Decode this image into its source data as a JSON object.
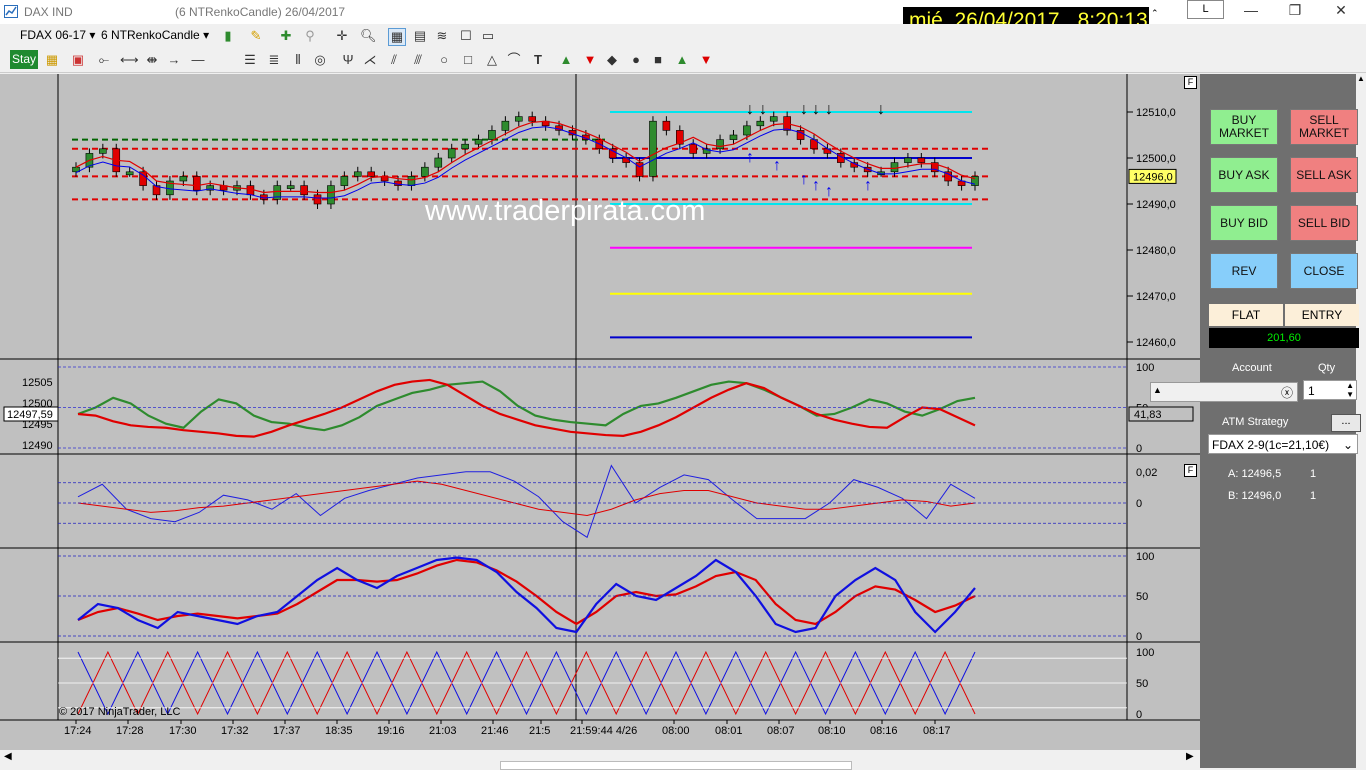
{
  "window": {
    "title": "DAX IND",
    "subtitle": "(6 NTRenkoCandle)  26/04/2017",
    "l_button": "L",
    "min_glyph": "—",
    "max_glyph": "❐",
    "close_glyph": "✕"
  },
  "clock": {
    "date": "mié. 26/04/2017",
    "time": "8:20:13"
  },
  "toolbar": {
    "instrument": "FDAX 06-17",
    "bartype": "6 NTRenkoCandle",
    "dropdown_glyph": "▾",
    "stay_label": "Stay"
  },
  "watermark": "www.traderpirata.com",
  "copyright": "© 2017 NinjaTrader, LLC",
  "colors": {
    "bull": "#2e8b2e",
    "bear": "#e00000",
    "panel_bg": "#c0c0c0",
    "accent_cyan": "#00e5ee",
    "accent_magenta": "#ff00ff",
    "accent_yellow": "#ffff00"
  },
  "price_axis": {
    "ticks": [
      "12510,0",
      "12500,0",
      "12490,0",
      "12480,0",
      "12470,0",
      "12460,0"
    ],
    "current": "12496,0"
  },
  "osc1_axis": {
    "right_ticks": [
      "100",
      "50",
      "0"
    ],
    "left_ticks": [
      "12505",
      "12500",
      "12495",
      "12490"
    ],
    "left_marker": "12497,59",
    "right_marker": "41,83"
  },
  "osc2_axis": {
    "right_ticks": [
      "0,02",
      "0"
    ]
  },
  "osc3_axis": {
    "right_ticks": [
      "100",
      "50",
      "0"
    ]
  },
  "osc4_axis": {
    "right_ticks": [
      "100",
      "50",
      "0"
    ]
  },
  "time_axis": [
    "17:24",
    "17:28",
    "17:30",
    "17:32",
    "17:37",
    "18:35",
    "19:16",
    "21:03",
    "21:46",
    "21:5",
    "21:59:44 4/26",
    "08:00",
    "08:01",
    "08:07",
    "08:10",
    "08:16",
    "08:17"
  ],
  "panel_flag": "F",
  "chart_data": {
    "type": "line",
    "title": "",
    "xlabel": "",
    "ylabel": "",
    "ylim": [
      12457,
      12514
    ],
    "price_closes": [
      12498,
      12501,
      12502,
      12497,
      12497,
      12494,
      12492,
      12495,
      12496,
      12493,
      12494,
      12493,
      12494,
      12492,
      12491,
      12494,
      12494,
      12492,
      12490,
      12494,
      12496,
      12497,
      12496,
      12495,
      12494,
      12496,
      12498,
      12500,
      12502,
      12503,
      12504,
      12506,
      12508,
      12509,
      12508,
      12507,
      12506,
      12505,
      12504,
      12502,
      12500,
      12499,
      12496,
      12508,
      12506,
      12503,
      12501,
      12502,
      12504,
      12505,
      12507,
      12508,
      12509,
      12506,
      12504,
      12502,
      12501,
      12499,
      12498,
      12497,
      12497,
      12499,
      12500,
      12499,
      12497,
      12495,
      12494,
      12496
    ],
    "levels": [
      {
        "value": 12504,
        "color": "#006400",
        "style": "dashed"
      },
      {
        "value": 12502,
        "color": "#e00000",
        "style": "dashed"
      },
      {
        "value": 12496,
        "color": "#e00000",
        "style": "dashed"
      },
      {
        "value": 12491,
        "color": "#e00000",
        "style": "dashed"
      },
      {
        "value": 12510,
        "color": "#00e5ee",
        "style": "solid"
      },
      {
        "value": 12500,
        "color": "#0000cc",
        "style": "solid"
      },
      {
        "value": 12490,
        "color": "#00e5ee",
        "style": "solid"
      },
      {
        "value": 12480.5,
        "color": "#ff00ff",
        "style": "solid"
      },
      {
        "value": 12470.5,
        "color": "#ffff00",
        "style": "solid"
      },
      {
        "value": 12461,
        "color": "#0000cc",
        "style": "solid"
      }
    ],
    "osc1": {
      "green": [
        42,
        50,
        62,
        55,
        40,
        30,
        25,
        45,
        60,
        55,
        40,
        32,
        30,
        25,
        22,
        28,
        38,
        52,
        60,
        68,
        72,
        78,
        80,
        82,
        70,
        52,
        40,
        35,
        32,
        30,
        28,
        42,
        52,
        55,
        62,
        70,
        78,
        82,
        80,
        72,
        62,
        52,
        40,
        42,
        50,
        60,
        55,
        45,
        40,
        48,
        58,
        62
      ],
      "red": [
        42,
        40,
        33,
        28,
        26,
        25,
        22,
        20,
        18,
        15,
        14,
        20,
        28,
        35,
        42,
        50,
        60,
        70,
        78,
        82,
        84,
        78,
        65,
        52,
        42,
        35,
        28,
        24,
        20,
        18,
        16,
        15,
        20,
        28,
        38,
        50,
        62,
        72,
        80,
        74,
        62,
        52,
        42,
        35,
        30,
        26,
        25,
        38,
        50,
        48,
        38,
        28
      ]
    },
    "osc2": {
      "blue": [
        0.004,
        0.012,
        -0.004,
        -0.01,
        -0.012,
        -0.006,
        0.005,
        0.002,
        -0.004,
        0.006,
        -0.008,
        0.003,
        0.008,
        0.012,
        0.016,
        0.018,
        0.02,
        0.02,
        0.014,
        0.004,
        -0.012,
        -0.022,
        0.024,
        0.0,
        0.01,
        0.018,
        0.015,
        0.002,
        -0.01,
        -0.01,
        -0.01,
        0.0,
        0.015,
        0.01,
        0.003,
        -0.01,
        0.012,
        0.003
      ],
      "red": [
        0.0,
        -0.002,
        -0.004,
        -0.006,
        -0.005,
        -0.003,
        -0.002,
        0.0,
        0.002,
        0.004,
        0.006,
        0.008,
        0.01,
        0.012,
        0.014,
        0.012,
        0.008,
        0.004,
        0.0,
        -0.004,
        -0.006,
        -0.008,
        -0.004,
        0.002,
        0.006,
        0.008,
        0.008,
        0.004,
        0.0,
        -0.002,
        -0.004,
        -0.004,
        -0.002,
        0.0,
        0.002,
        0.001,
        -0.002,
        0.0
      ]
    },
    "osc3": {
      "blue": [
        20,
        40,
        35,
        20,
        10,
        30,
        25,
        20,
        15,
        25,
        30,
        50,
        70,
        85,
        70,
        60,
        75,
        85,
        95,
        98,
        95,
        80,
        55,
        35,
        10,
        5,
        40,
        65,
        50,
        45,
        60,
        75,
        95,
        80,
        50,
        15,
        5,
        10,
        50,
        70,
        85,
        70,
        30,
        5,
        30,
        60
      ],
      "red": [
        20,
        30,
        35,
        28,
        20,
        25,
        28,
        25,
        22,
        25,
        28,
        40,
        55,
        70,
        70,
        68,
        70,
        78,
        88,
        95,
        92,
        82,
        68,
        50,
        30,
        15,
        30,
        50,
        55,
        50,
        52,
        62,
        75,
        80,
        70,
        40,
        20,
        15,
        30,
        50,
        62,
        58,
        45,
        30,
        38,
        50
      ]
    },
    "osc4": {
      "blue": [
        100,
        0,
        100,
        0,
        100,
        0,
        100,
        0,
        100,
        0,
        100,
        0,
        100,
        0,
        100,
        0,
        100,
        0,
        100,
        0,
        100,
        0,
        100,
        0,
        100,
        0,
        100,
        0,
        100,
        0,
        100
      ],
      "red": [
        0,
        100,
        0,
        100,
        0,
        100,
        0,
        100,
        0,
        100,
        0,
        100,
        0,
        100,
        0,
        100,
        0,
        100,
        0,
        100,
        0,
        100,
        0,
        100,
        0,
        100,
        0,
        100,
        0,
        100,
        0
      ]
    }
  },
  "orders": {
    "buy_market": "BUY MARKET",
    "sell_market": "SELL MARKET",
    "buy_ask": "BUY ASK",
    "sell_ask": "SELL ASK",
    "buy_bid": "BUY BID",
    "sell_bid": "SELL BID",
    "rev": "REV",
    "close": "CLOSE",
    "flat": "FLAT",
    "entry": "ENTRY",
    "pnl": "201,60",
    "account_label": "Account",
    "qty_label": "Qty",
    "qty_value": "1",
    "atm_label": "ATM Strategy",
    "atm_button": "...",
    "atm_value": "FDAX 2-9(1c=21,10€)",
    "a_label": "A: 12496,5",
    "a_qty": "1",
    "b_label": "B: 12496,0",
    "b_qty": "1"
  }
}
